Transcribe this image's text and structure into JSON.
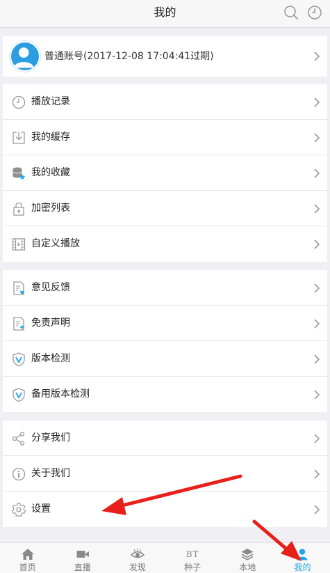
{
  "header": {
    "title": "我的",
    "search_icon": "search-icon",
    "history_icon": "clock-icon"
  },
  "account": {
    "label": "普通账号(2017-12-08 17:04:41过期)",
    "avatar_color": "#2c9de0"
  },
  "groups": [
    {
      "items": [
        {
          "label": "播放记录",
          "icon": "clock-icon"
        },
        {
          "label": "我的缓存",
          "icon": "download-icon"
        },
        {
          "label": "我的收藏",
          "icon": "favorites-icon"
        },
        {
          "label": "加密列表",
          "icon": "lock-icon"
        },
        {
          "label": "自定义播放",
          "icon": "film-icon"
        }
      ]
    },
    {
      "items": [
        {
          "label": "意见反馈",
          "icon": "feedback-icon"
        },
        {
          "label": "免责声明",
          "icon": "disclaimer-icon"
        },
        {
          "label": "版本检测",
          "icon": "version-check-icon"
        },
        {
          "label": "备用版本检测",
          "icon": "backup-version-check-icon"
        }
      ]
    },
    {
      "items": [
        {
          "label": "分享我们",
          "icon": "share-icon"
        },
        {
          "label": "关于我们",
          "icon": "info-icon"
        },
        {
          "label": "设置",
          "icon": "settings-icon"
        }
      ]
    }
  ],
  "tabbar": {
    "tabs": [
      {
        "label": "首页",
        "icon": "home-icon"
      },
      {
        "label": "直播",
        "icon": "video-camera-icon"
      },
      {
        "label": "发现",
        "icon": "eye-icon"
      },
      {
        "label": "种子",
        "icon": "bt-icon",
        "glyph": "BT"
      },
      {
        "label": "本地",
        "icon": "layers-icon"
      },
      {
        "label": "我的",
        "icon": "user-icon"
      }
    ],
    "active_index": 5,
    "active_color": "#23a5e9"
  },
  "annotation_color": "#e8201c"
}
